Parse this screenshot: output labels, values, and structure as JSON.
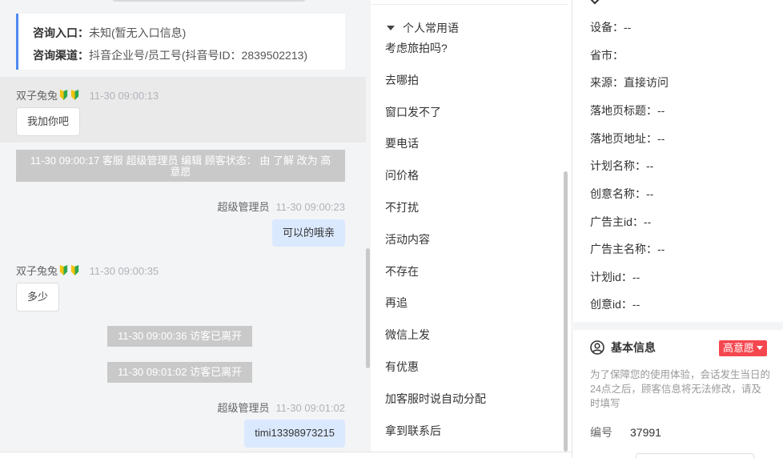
{
  "entry_card": {
    "entry_label": "咨询入口：",
    "entry_value": "未知(暂无入口信息)",
    "channel_label": "咨询渠道：",
    "channel_value": "抖音企业号/员工号(抖音号ID：2839502213)"
  },
  "messages": {
    "visitor_name": "双子兔兔",
    "agent_name": "超级管理员",
    "m1_time": "11-30 09:00:13",
    "m1_text": "我加你吧",
    "sys1_text": "11-30 09:00:17 客服 超级管理员 编辑 顾客状态： 由 了解 改为 高意愿",
    "m2_time": "11-30 09:00:23",
    "m2_text": "可以的哦亲",
    "m3_time": "11-30 09:00:35",
    "m3_text": "多少",
    "sys2_text": "11-30 09:00:36 访客已离开",
    "sys3_text": "11-30 09:01:02 访客已离开",
    "m4_time": "11-30 09:01:02",
    "m4_text": "timi13398973215"
  },
  "phrases": {
    "group_title": "个人常用语",
    "items": [
      "考虑旅拍吗?",
      "去哪拍",
      "窗口发不了",
      "要电话",
      "问价格",
      "不打扰",
      "活动内容",
      "不存在",
      "再追",
      "微信上发",
      "有优惠",
      "加客服时说自动分配",
      "拿到联系后"
    ]
  },
  "info": {
    "rows": [
      {
        "label": "设备：",
        "value": "--"
      },
      {
        "label": "省市：",
        "value": ""
      },
      {
        "label": "来源：",
        "value": "直接访问"
      },
      {
        "label": "落地页标题：",
        "value": "--"
      },
      {
        "label": "落地页地址：",
        "value": "--"
      },
      {
        "label": "计划名称：",
        "value": "--"
      },
      {
        "label": "创意名称：",
        "value": "--"
      },
      {
        "label": "广告主id：",
        "value": "--"
      },
      {
        "label": "广告主名称：",
        "value": "--"
      },
      {
        "label": "计划id：",
        "value": "--"
      },
      {
        "label": "创意id：",
        "value": "--"
      }
    ],
    "basic_title": "基本信息",
    "intent_tag": "高意愿",
    "notice": "为了保障您的使用体验，会话发生当日的24点之后，顾客信息将无法修改，请及时填写",
    "id_label": "编号",
    "id_value": "37991"
  },
  "colors": {
    "accent_blue": "#4d8af0",
    "agent_bubble": "#dbe9ff",
    "system_pill": "#c9c9c9",
    "intent_red": "#f5474f"
  },
  "icons": {
    "visitor_badge": "beginner-leaf-icon",
    "phrase_group_toggle": "caret-down-icon",
    "basic_info": "user-circle-icon",
    "intent_dropdown": "caret-down-icon"
  }
}
